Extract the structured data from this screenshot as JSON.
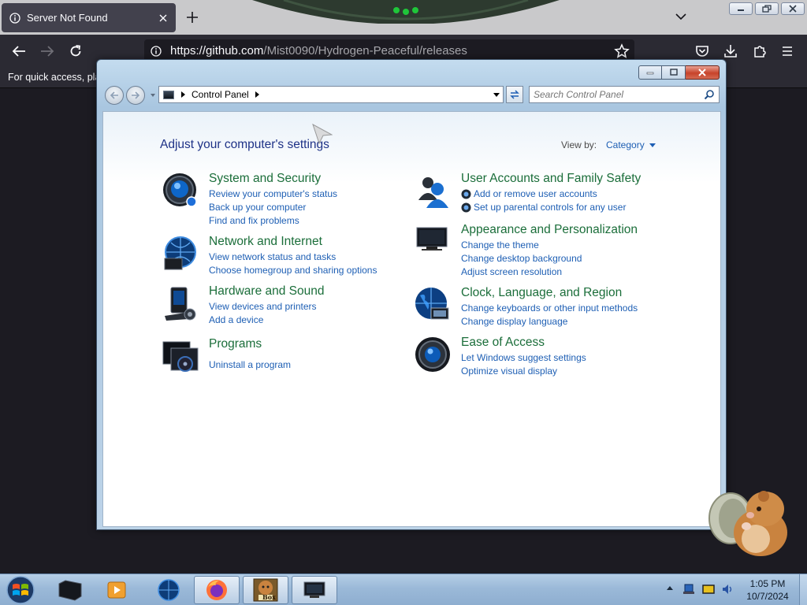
{
  "browser": {
    "tab_title": "Server Not Found",
    "url_host": "https://github.com",
    "url_path": "/Mist0090/Hydrogen-Peaceful/releases",
    "bookmarks_hint": "For quick access, plac"
  },
  "control_panel": {
    "breadcrumb": "Control Panel",
    "search_placeholder": "Search Control Panel",
    "heading": "Adjust your computer's settings",
    "view_by_label": "View by:",
    "view_by_value": "Category",
    "categories": [
      {
        "title": "System and Security",
        "icon": "shield-icon",
        "links": [
          "Review your computer's status",
          "Back up your computer",
          "Find and fix problems"
        ]
      },
      {
        "title": "Network and Internet",
        "icon": "network-icon",
        "links": [
          "View network status and tasks",
          "Choose homegroup and sharing options"
        ]
      },
      {
        "title": "Hardware and Sound",
        "icon": "printer-icon",
        "links": [
          "View devices and printers",
          "Add a device"
        ]
      },
      {
        "title": "Programs",
        "icon": "programs-icon",
        "links": [
          "Uninstall a program"
        ]
      },
      {
        "title": "User Accounts and Family Safety",
        "icon": "users-icon",
        "links": [
          "Add or remove user accounts",
          "Set up parental controls for any user"
        ]
      },
      {
        "title": "Appearance and Personalization",
        "icon": "monitor-icon",
        "links": [
          "Change the theme",
          "Change desktop background",
          "Adjust screen resolution"
        ]
      },
      {
        "title": "Clock, Language, and Region",
        "icon": "globe-clock-icon",
        "links": [
          "Change keyboards or other input methods",
          "Change display language"
        ]
      },
      {
        "title": "Ease of Access",
        "icon": "ease-of-access-icon",
        "links": [
          "Let Windows suggest settings",
          "Optimize visual display"
        ]
      }
    ]
  },
  "taskbar": {
    "time": "1:05 PM",
    "date": "10/7/2024",
    "box_app_label": "Box"
  },
  "colors": {
    "category_title": "#1b6e3a",
    "link": "#1e5fb4",
    "heading": "#1e3287",
    "browser_dark": "#2b2a33"
  }
}
